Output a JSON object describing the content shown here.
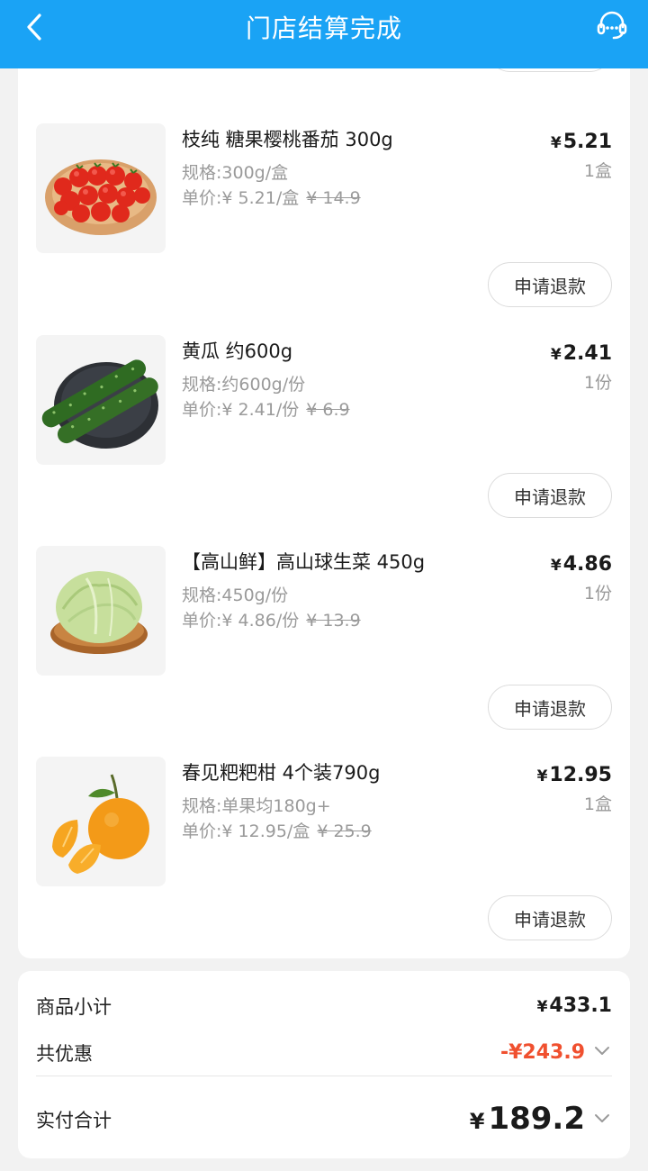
{
  "header": {
    "title": "门店结算完成"
  },
  "items": [
    {
      "name": "枝纯 糖果樱桃番茄 300g",
      "spec": "规格:300g/盒",
      "unit_price_label": "单价:¥ 5.21/盒",
      "original_price": "¥ 14.9",
      "price": "5.21",
      "quantity": "1盒",
      "image_icon": "cherry-tomatoes-image"
    },
    {
      "name": "黄瓜 约600g",
      "spec": "规格:约600g/份",
      "unit_price_label": "单价:¥ 2.41/份",
      "original_price": "¥ 6.9",
      "price": "2.41",
      "quantity": "1份",
      "image_icon": "cucumber-image"
    },
    {
      "name": "【高山鲜】高山球生菜 450g",
      "spec": "规格:450g/份",
      "unit_price_label": "单价:¥ 4.86/份",
      "original_price": "¥ 13.9",
      "price": "4.86",
      "quantity": "1份",
      "image_icon": "lettuce-image"
    },
    {
      "name": "春见粑粑柑 4个装790g",
      "spec": "规格:单果均180g+",
      "unit_price_label": "单价:¥ 12.95/盒",
      "original_price": "¥ 25.9",
      "price": "12.95",
      "quantity": "1盒",
      "image_icon": "tangerine-image"
    }
  ],
  "refund_label": "申请退款",
  "currency_symbol": "¥",
  "summary": {
    "subtotal_label": "商品小计",
    "subtotal_value": "433.1",
    "discount_label": "共优惠",
    "discount_value": "-¥243.9",
    "total_label": "实付合计",
    "total_value": "189.2"
  },
  "colors": {
    "header_bg": "#1aa3f5",
    "discount": "#f0502f",
    "page_bg": "#f2f2f2"
  }
}
